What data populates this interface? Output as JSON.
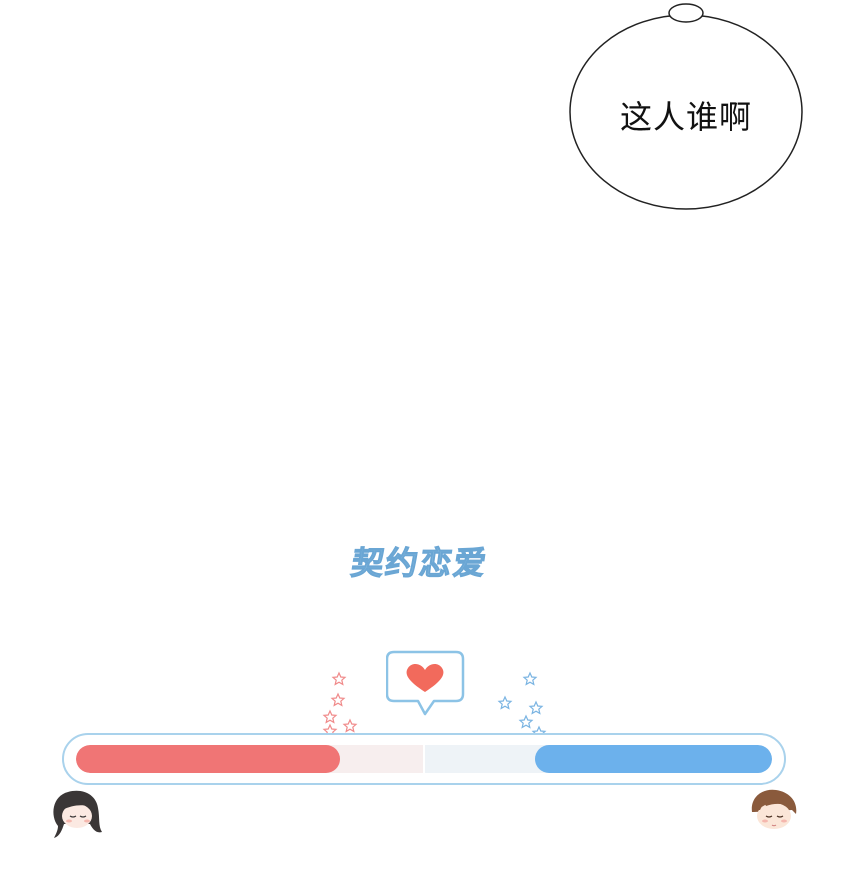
{
  "speech_bubble": {
    "text": "这人谁啊"
  },
  "logo": {
    "text": "契约恋爱"
  },
  "affection_meter": {
    "left_level": 0.38,
    "right_level": 0.34,
    "left_color": "#f07575",
    "right_color": "#6cb1ec",
    "frame_color": "#a9d2ec",
    "heart_color": "#f26a5c"
  },
  "icons": {
    "heart": "heart-icon",
    "left_avatar": "girl-avatar-icon",
    "right_avatar": "boy-avatar-icon"
  }
}
